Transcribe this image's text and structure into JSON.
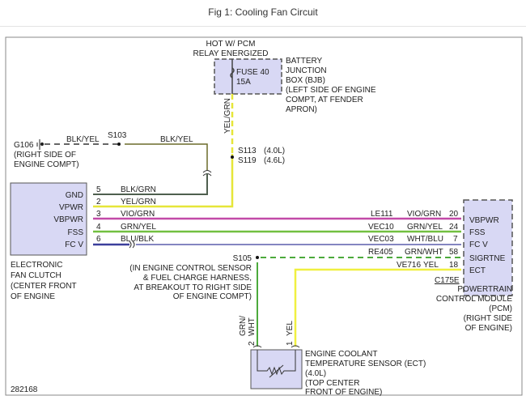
{
  "header": {
    "title": "Fig 1: Cooling Fan Circuit"
  },
  "figure_id": "282168",
  "colors": {
    "component_fill": "#d8d8f4",
    "yel_grn": "#e6e639",
    "blk_yel": "#6b6b2a",
    "blk_grn": "#4f5f4f",
    "vio_grn": "#c24aa8",
    "grn_yel": "#72c040",
    "blu_blk": "#3b3f9c",
    "grn_wht": "#4caa3c",
    "yel": "#f0f040"
  },
  "bjb": {
    "hot_note": [
      "HOT W/ PCM",
      "RELAY ENERGIZED"
    ],
    "fuse": "FUSE 40",
    "rating": "15A",
    "label": [
      "BATTERY",
      "JUNCTION",
      "BOX (BJB)",
      "(LEFT SIDE OF ENGINE",
      "COMPT, AT FENDER",
      "APRON)"
    ],
    "wire": "YEL/GRN"
  },
  "splices": {
    "s113": "S113",
    "s113_engine": "(4.0L)",
    "s119": "S119",
    "s119_engine": "(4.6L)",
    "s103": "S103",
    "s105": "S105",
    "s105_note": [
      "(IN ENGINE CONTROL SENSOR",
      "& FUEL CHARGE HARNESS,",
      "AT BREAKOUT TO RIGHT SIDE",
      "OF ENGINE COMPT)"
    ]
  },
  "ground": {
    "id": "G106",
    "note": [
      "(RIGHT SIDE OF",
      "ENGINE COMPT)"
    ],
    "wire_left": "BLK/YEL",
    "wire_right": "BLK/YEL"
  },
  "fan_clutch": {
    "pins": [
      "GND",
      "VPWR",
      "VBPWR",
      "FSS",
      "FC V"
    ],
    "label": [
      "ELECTRONIC",
      "FAN CLUTCH",
      "(CENTER FRONT",
      "OF ENGINE"
    ]
  },
  "wires": [
    {
      "pin": "5",
      "color": "BLK/GRN"
    },
    {
      "pin": "2",
      "color": "YEL/GRN"
    },
    {
      "pin": "3",
      "color": "VIO/GRN",
      "circuit": "LE111",
      "pcm_color": "VIO/GRN",
      "pcm_pin": "20"
    },
    {
      "pin": "4",
      "color": "GRN/YEL",
      "circuit": "VEC10",
      "pcm_color": "GRN/YEL",
      "pcm_pin": "24"
    },
    {
      "pin": "6",
      "color": "BLU/BLK",
      "circuit": "VEC03",
      "pcm_color": "WHT/BLU",
      "pcm_pin": "7"
    }
  ],
  "pcm_extra": [
    {
      "circuit": "RE405",
      "color": "GRN/WHT",
      "pin": "58"
    },
    {
      "circuit": "VE716",
      "color": "YEL",
      "pin": "18"
    }
  ],
  "pcm": {
    "pins": [
      "VBPWR",
      "FSS",
      "FC V",
      "SIGRTNE",
      "ECT"
    ],
    "connector": "C175E",
    "label": [
      "POWERTRAIN",
      "CONTROL MODULE",
      "(PCM)",
      "(RIGHT SIDE",
      "OF ENGINE)"
    ]
  },
  "ect": {
    "pin2": "2",
    "pin2_color_a": "GRN/",
    "pin2_color_b": "WHT",
    "pin1": "1",
    "pin1_color": "YEL",
    "label": [
      "ENGINE COOLANT",
      "TEMPERATURE SENSOR (ECT)",
      "(4.0L)",
      "(TOP CENTER",
      "FRONT OF ENGINE)"
    ]
  }
}
